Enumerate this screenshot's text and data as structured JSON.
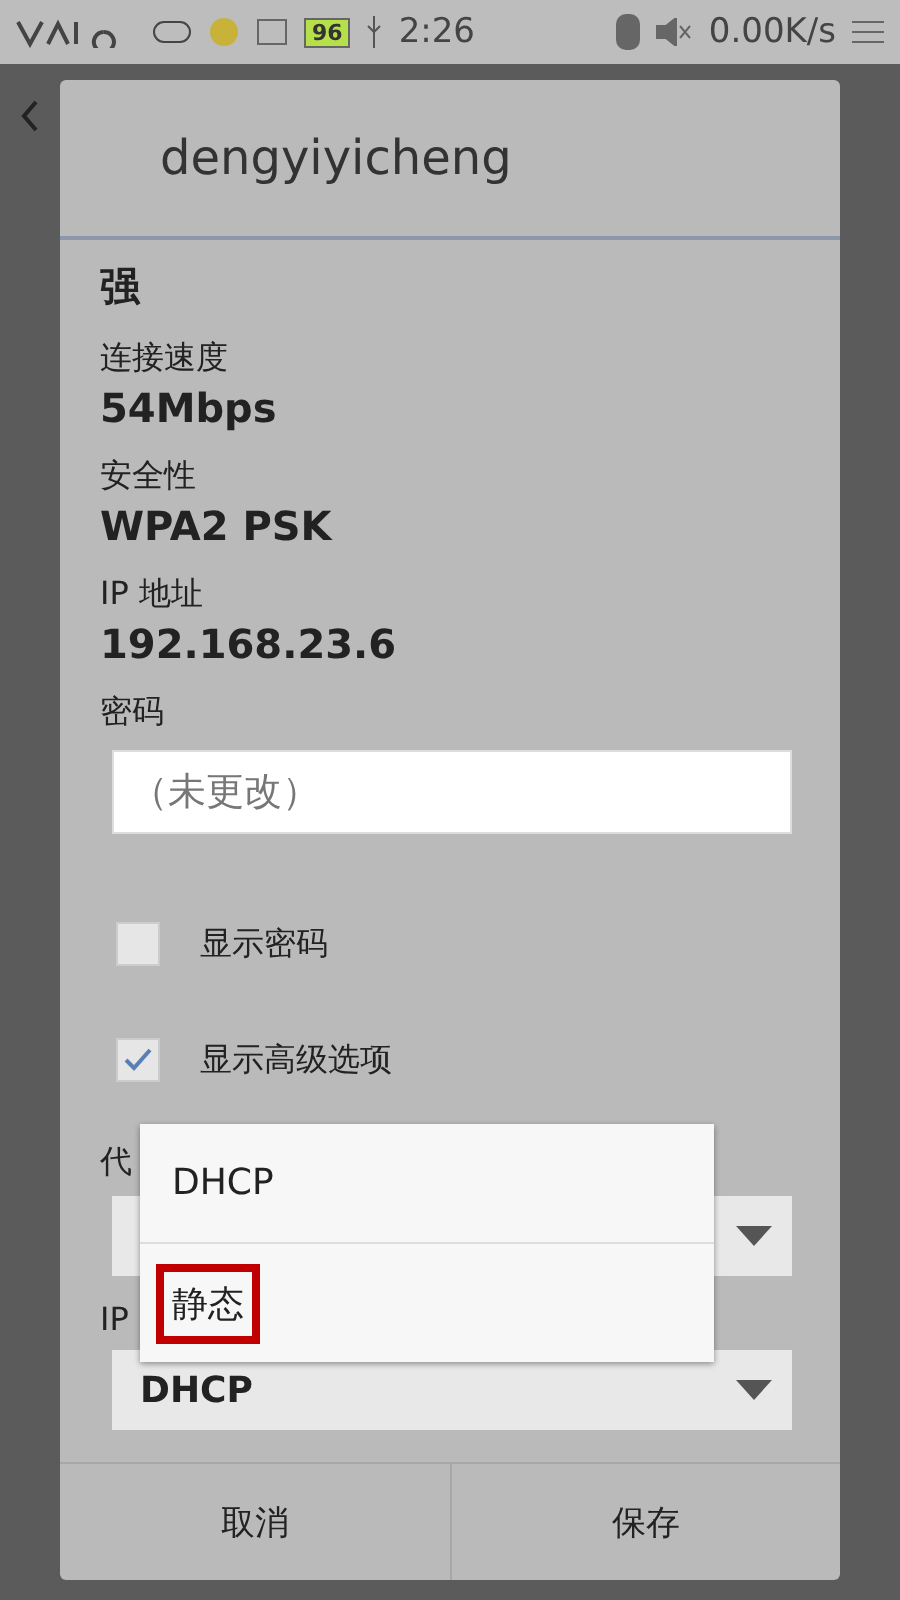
{
  "status_bar": {
    "battery": "96",
    "time": "2:26",
    "speed": "0.00K/s"
  },
  "dialog": {
    "title": "dengyiyicheng",
    "details": [
      {
        "value": "强"
      },
      {
        "label": "连接速度",
        "value": "54Mbps"
      },
      {
        "label": "安全性",
        "value": "WPA2 PSK"
      },
      {
        "label": "IP 地址",
        "value": "192.168.23.6"
      }
    ],
    "password": {
      "label": "密码",
      "placeholder": "（未更改）"
    },
    "checkboxes": [
      {
        "label": "显示密码",
        "checked": false
      },
      {
        "label": "显示高级选项",
        "checked": true
      }
    ],
    "selects": [
      {
        "label": "代"
      },
      {
        "label": "IP",
        "value": "DHCP"
      }
    ],
    "buttons": [
      "取消",
      "保存"
    ]
  },
  "popup": {
    "options": [
      {
        "label": "DHCP",
        "highlighted": false
      },
      {
        "label": "静态",
        "highlighted": true
      }
    ]
  }
}
